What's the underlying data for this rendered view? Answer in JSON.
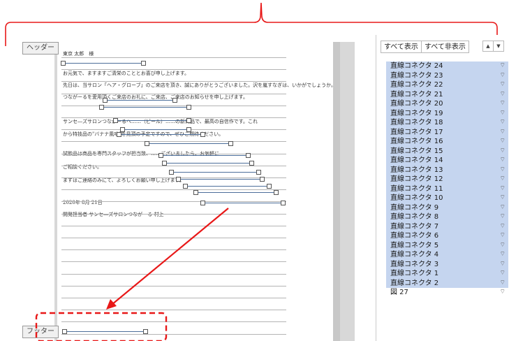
{
  "document": {
    "header_tab": "ヘッダー",
    "footer_tab": "フッター",
    "lines": [
      "東京 太郎　様",
      "お元気で、ますますご清栄のこととお喜び申し上げます。",
      "先日は、当サロン「ヘア・グローブ」のご来店を頂き、誠にありがとうございました。沢を嵐すなぎは、いかがでしょうか。",
      "つながーるを愛用頂くご来店のお礼に、ご来店、ご来店のお知らせを申し上げます。",
      "サンセ―ズサロンつながーるへ……（ビール）……の新商品で、最高の自信作です。これ",
      "から特技品の\"バナナ風味\"を見頂の予定ですので、ぜひご期待ください。",
      "試飲品は商品を専門スタッフが担当致、……ございましたら、お気軽に",
      "ご相談ください。",
      "まずはご連絡のみにて、よろしくお願い申し上げます。",
      "2020年 8月 21日",
      "開発担当者 サンセ―ズサロンつながーる 村上"
    ]
  },
  "selection_pane": {
    "show_all": "すべて表示",
    "hide_all": "すべて非表示",
    "items": [
      {
        "label": "直線コネクタ 24",
        "selected": true
      },
      {
        "label": "直線コネクタ 23",
        "selected": true
      },
      {
        "label": "直線コネクタ 22",
        "selected": true
      },
      {
        "label": "直線コネクタ 21",
        "selected": true
      },
      {
        "label": "直線コネクタ 20",
        "selected": true
      },
      {
        "label": "直線コネクタ 19",
        "selected": true
      },
      {
        "label": "直線コネクタ 18",
        "selected": true
      },
      {
        "label": "直線コネクタ 17",
        "selected": true
      },
      {
        "label": "直線コネクタ 16",
        "selected": true
      },
      {
        "label": "直線コネクタ 15",
        "selected": true
      },
      {
        "label": "直線コネクタ 14",
        "selected": true
      },
      {
        "label": "直線コネクタ 13",
        "selected": true
      },
      {
        "label": "直線コネクタ 12",
        "selected": true
      },
      {
        "label": "直線コネクタ 11",
        "selected": true
      },
      {
        "label": "直線コネクタ 10",
        "selected": true
      },
      {
        "label": "直線コネクタ 9",
        "selected": true
      },
      {
        "label": "直線コネクタ 8",
        "selected": true
      },
      {
        "label": "直線コネクタ 7",
        "selected": true
      },
      {
        "label": "直線コネクタ 6",
        "selected": true
      },
      {
        "label": "直線コネクタ 5",
        "selected": true
      },
      {
        "label": "直線コネクタ 4",
        "selected": true
      },
      {
        "label": "直線コネクタ 3",
        "selected": true
      },
      {
        "label": "直線コネクタ 1",
        "selected": true
      },
      {
        "label": "直線コネクタ 2",
        "selected": true
      },
      {
        "label": "図 27",
        "selected": false
      }
    ],
    "eye_glyph": "⌔"
  },
  "colors": {
    "annotation_red": "#e81818",
    "selection_blue": "#c5d5ef",
    "connector": "#4c6e9a"
  }
}
